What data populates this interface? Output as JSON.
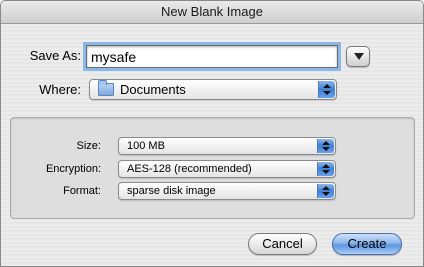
{
  "window": {
    "title": "New Blank Image"
  },
  "save_as": {
    "label": "Save As:",
    "value": "mysafe"
  },
  "where": {
    "label": "Where:",
    "value": "Documents",
    "icon": "folder-icon"
  },
  "options": {
    "size": {
      "label": "Size:",
      "value": "100 MB"
    },
    "encryption": {
      "label": "Encryption:",
      "value": "AES-128 (recommended)"
    },
    "format": {
      "label": "Format:",
      "value": "sparse disk image"
    }
  },
  "buttons": {
    "cancel": "Cancel",
    "create": "Create"
  },
  "colors": {
    "focus_ring": "#8bb6e8",
    "popup_arrows": "#3f7fd6",
    "default_button": "#5b95e0"
  }
}
